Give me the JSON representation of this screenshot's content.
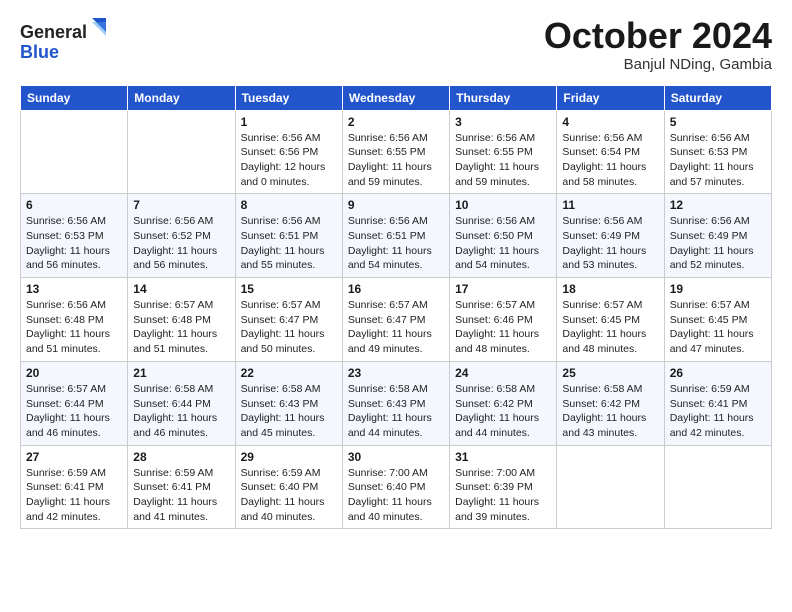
{
  "header": {
    "logo_general": "General",
    "logo_blue": "Blue",
    "title": "October 2024",
    "location": "Banjul NDing, Gambia"
  },
  "weekdays": [
    "Sunday",
    "Monday",
    "Tuesday",
    "Wednesday",
    "Thursday",
    "Friday",
    "Saturday"
  ],
  "weeks": [
    [
      {
        "day": "",
        "info": ""
      },
      {
        "day": "",
        "info": ""
      },
      {
        "day": "1",
        "info": "Sunrise: 6:56 AM\nSunset: 6:56 PM\nDaylight: 12 hours\nand 0 minutes."
      },
      {
        "day": "2",
        "info": "Sunrise: 6:56 AM\nSunset: 6:55 PM\nDaylight: 11 hours\nand 59 minutes."
      },
      {
        "day": "3",
        "info": "Sunrise: 6:56 AM\nSunset: 6:55 PM\nDaylight: 11 hours\nand 59 minutes."
      },
      {
        "day": "4",
        "info": "Sunrise: 6:56 AM\nSunset: 6:54 PM\nDaylight: 11 hours\nand 58 minutes."
      },
      {
        "day": "5",
        "info": "Sunrise: 6:56 AM\nSunset: 6:53 PM\nDaylight: 11 hours\nand 57 minutes."
      }
    ],
    [
      {
        "day": "6",
        "info": "Sunrise: 6:56 AM\nSunset: 6:53 PM\nDaylight: 11 hours\nand 56 minutes."
      },
      {
        "day": "7",
        "info": "Sunrise: 6:56 AM\nSunset: 6:52 PM\nDaylight: 11 hours\nand 56 minutes."
      },
      {
        "day": "8",
        "info": "Sunrise: 6:56 AM\nSunset: 6:51 PM\nDaylight: 11 hours\nand 55 minutes."
      },
      {
        "day": "9",
        "info": "Sunrise: 6:56 AM\nSunset: 6:51 PM\nDaylight: 11 hours\nand 54 minutes."
      },
      {
        "day": "10",
        "info": "Sunrise: 6:56 AM\nSunset: 6:50 PM\nDaylight: 11 hours\nand 54 minutes."
      },
      {
        "day": "11",
        "info": "Sunrise: 6:56 AM\nSunset: 6:49 PM\nDaylight: 11 hours\nand 53 minutes."
      },
      {
        "day": "12",
        "info": "Sunrise: 6:56 AM\nSunset: 6:49 PM\nDaylight: 11 hours\nand 52 minutes."
      }
    ],
    [
      {
        "day": "13",
        "info": "Sunrise: 6:56 AM\nSunset: 6:48 PM\nDaylight: 11 hours\nand 51 minutes."
      },
      {
        "day": "14",
        "info": "Sunrise: 6:57 AM\nSunset: 6:48 PM\nDaylight: 11 hours\nand 51 minutes."
      },
      {
        "day": "15",
        "info": "Sunrise: 6:57 AM\nSunset: 6:47 PM\nDaylight: 11 hours\nand 50 minutes."
      },
      {
        "day": "16",
        "info": "Sunrise: 6:57 AM\nSunset: 6:47 PM\nDaylight: 11 hours\nand 49 minutes."
      },
      {
        "day": "17",
        "info": "Sunrise: 6:57 AM\nSunset: 6:46 PM\nDaylight: 11 hours\nand 48 minutes."
      },
      {
        "day": "18",
        "info": "Sunrise: 6:57 AM\nSunset: 6:45 PM\nDaylight: 11 hours\nand 48 minutes."
      },
      {
        "day": "19",
        "info": "Sunrise: 6:57 AM\nSunset: 6:45 PM\nDaylight: 11 hours\nand 47 minutes."
      }
    ],
    [
      {
        "day": "20",
        "info": "Sunrise: 6:57 AM\nSunset: 6:44 PM\nDaylight: 11 hours\nand 46 minutes."
      },
      {
        "day": "21",
        "info": "Sunrise: 6:58 AM\nSunset: 6:44 PM\nDaylight: 11 hours\nand 46 minutes."
      },
      {
        "day": "22",
        "info": "Sunrise: 6:58 AM\nSunset: 6:43 PM\nDaylight: 11 hours\nand 45 minutes."
      },
      {
        "day": "23",
        "info": "Sunrise: 6:58 AM\nSunset: 6:43 PM\nDaylight: 11 hours\nand 44 minutes."
      },
      {
        "day": "24",
        "info": "Sunrise: 6:58 AM\nSunset: 6:42 PM\nDaylight: 11 hours\nand 44 minutes."
      },
      {
        "day": "25",
        "info": "Sunrise: 6:58 AM\nSunset: 6:42 PM\nDaylight: 11 hours\nand 43 minutes."
      },
      {
        "day": "26",
        "info": "Sunrise: 6:59 AM\nSunset: 6:41 PM\nDaylight: 11 hours\nand 42 minutes."
      }
    ],
    [
      {
        "day": "27",
        "info": "Sunrise: 6:59 AM\nSunset: 6:41 PM\nDaylight: 11 hours\nand 42 minutes."
      },
      {
        "day": "28",
        "info": "Sunrise: 6:59 AM\nSunset: 6:41 PM\nDaylight: 11 hours\nand 41 minutes."
      },
      {
        "day": "29",
        "info": "Sunrise: 6:59 AM\nSunset: 6:40 PM\nDaylight: 11 hours\nand 40 minutes."
      },
      {
        "day": "30",
        "info": "Sunrise: 7:00 AM\nSunset: 6:40 PM\nDaylight: 11 hours\nand 40 minutes."
      },
      {
        "day": "31",
        "info": "Sunrise: 7:00 AM\nSunset: 6:39 PM\nDaylight: 11 hours\nand 39 minutes."
      },
      {
        "day": "",
        "info": ""
      },
      {
        "day": "",
        "info": ""
      }
    ]
  ]
}
